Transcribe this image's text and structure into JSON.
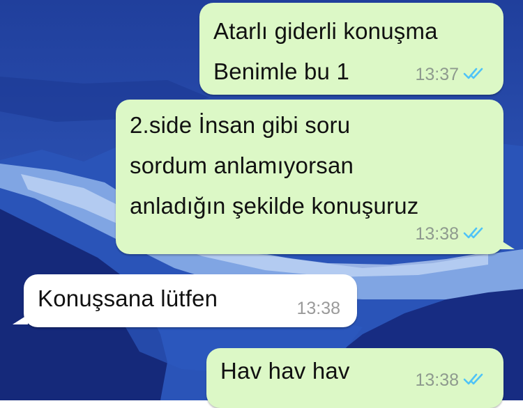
{
  "chat": {
    "messages": [
      {
        "direction": "outgoing",
        "text": "Atarlı giderli konuşma\nBenimle bu 1",
        "time": "13:37",
        "status_icon": "double-check-read-icon"
      },
      {
        "direction": "outgoing",
        "text": "2.side İnsan gibi soru\nsordum anlamıyorsan\nanladığın şekilde konuşuruz",
        "time": "13:38",
        "status_icon": "double-check-read-icon"
      },
      {
        "direction": "incoming",
        "text": "Konuşsana lütfen",
        "time": "13:38"
      },
      {
        "direction": "outgoing",
        "text": "Hav hav hav",
        "time": "13:38",
        "status_icon": "double-check-read-icon"
      }
    ]
  },
  "colors": {
    "outgoing_bubble": "#dcf8c6",
    "incoming_bubble": "#ffffff",
    "read_ticks": "#4fc3f7",
    "wallpaper": "#1f3f9e"
  }
}
